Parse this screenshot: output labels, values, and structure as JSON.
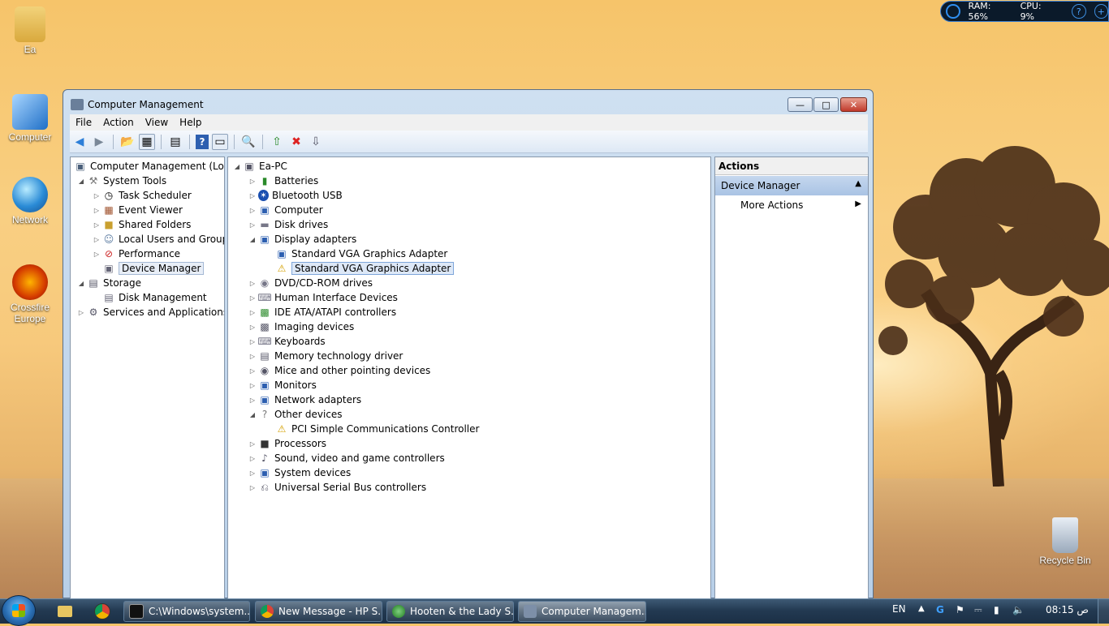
{
  "desktop": {
    "icons": [
      {
        "label": "Ea"
      },
      {
        "label": "Computer"
      },
      {
        "label": "Network"
      },
      {
        "label": "Crossfire Europe"
      },
      {
        "label": "Recycle Bin"
      }
    ]
  },
  "gadget": {
    "ram": "RAM: 56%",
    "cpu": "CPU: 9%"
  },
  "window": {
    "title": "Computer Management",
    "menu": [
      "File",
      "Action",
      "View",
      "Help"
    ]
  },
  "left_tree": [
    {
      "label": "Computer Management (Local"
    },
    {
      "label": "System Tools"
    },
    {
      "label": "Task Scheduler"
    },
    {
      "label": "Event Viewer"
    },
    {
      "label": "Shared Folders"
    },
    {
      "label": "Local Users and Groups"
    },
    {
      "label": "Performance"
    },
    {
      "label": "Device Manager"
    },
    {
      "label": "Storage"
    },
    {
      "label": "Disk Management"
    },
    {
      "label": "Services and Applications"
    }
  ],
  "device_tree": [
    {
      "label": "Ea-PC"
    },
    {
      "label": "Batteries"
    },
    {
      "label": "Bluetooth USB"
    },
    {
      "label": "Computer"
    },
    {
      "label": "Disk drives"
    },
    {
      "label": "Display adapters"
    },
    {
      "label": "Standard VGA Graphics Adapter"
    },
    {
      "label": "Standard VGA Graphics Adapter"
    },
    {
      "label": "DVD/CD-ROM drives"
    },
    {
      "label": "Human Interface Devices"
    },
    {
      "label": "IDE ATA/ATAPI controllers"
    },
    {
      "label": "Imaging devices"
    },
    {
      "label": "Keyboards"
    },
    {
      "label": "Memory technology driver"
    },
    {
      "label": "Mice and other pointing devices"
    },
    {
      "label": "Monitors"
    },
    {
      "label": "Network adapters"
    },
    {
      "label": "Other devices"
    },
    {
      "label": "PCI Simple Communications Controller"
    },
    {
      "label": "Processors"
    },
    {
      "label": "Sound, video and game controllers"
    },
    {
      "label": "System devices"
    },
    {
      "label": "Universal Serial Bus controllers"
    }
  ],
  "actions": {
    "header": "Actions",
    "section": "Device Manager",
    "item": "More Actions"
  },
  "taskbar": {
    "buttons": [
      {
        "label": "C:\\Windows\\system..."
      },
      {
        "label": "New Message - HP S..."
      },
      {
        "label": "Hooten & the Lady S..."
      },
      {
        "label": "Computer Managem..."
      }
    ],
    "lang": "EN",
    "clock": "08:15 ص"
  }
}
